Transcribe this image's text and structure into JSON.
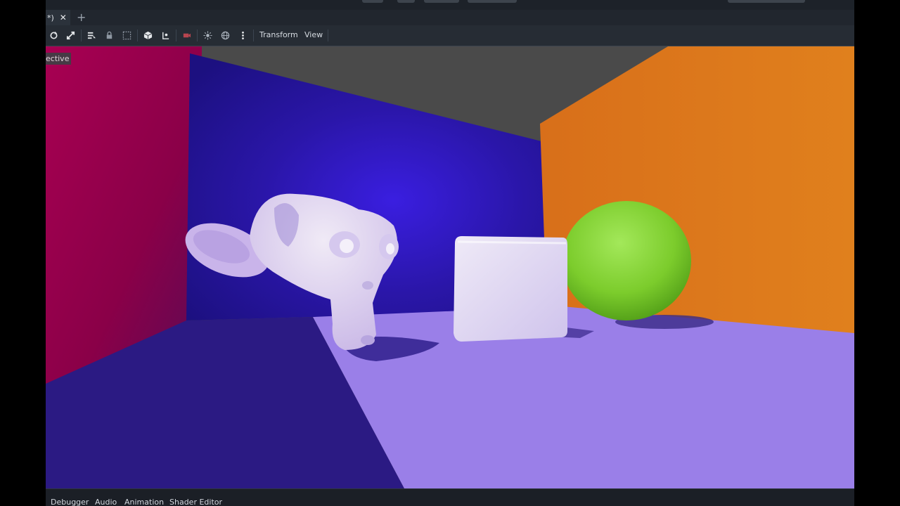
{
  "tab": {
    "title": "*)",
    "close_glyph": "✕",
    "add_glyph": "+"
  },
  "toolbar": {
    "icons": [
      "rotate-icon",
      "scale-icon",
      "list-select-icon",
      "lock-icon",
      "group-icon",
      "snap-icon",
      "local-space-icon",
      "camera-icon",
      "sun-icon",
      "environment-icon",
      "more-options-icon"
    ],
    "transform_label": "Transform",
    "view_label": "View"
  },
  "viewport": {
    "perspective_label": "ective"
  },
  "bottom_panel": {
    "tabs": [
      "Debugger",
      "Audio",
      "Animation",
      "Shader Editor"
    ]
  },
  "colors": {
    "editor_bg": "#1d2229",
    "wall_red": "#b0004e",
    "wall_blue": "#2a168f",
    "wall_orange": "#d6751f",
    "floor_purple": "#9a7fe8",
    "sphere_green": "#7fd030"
  }
}
